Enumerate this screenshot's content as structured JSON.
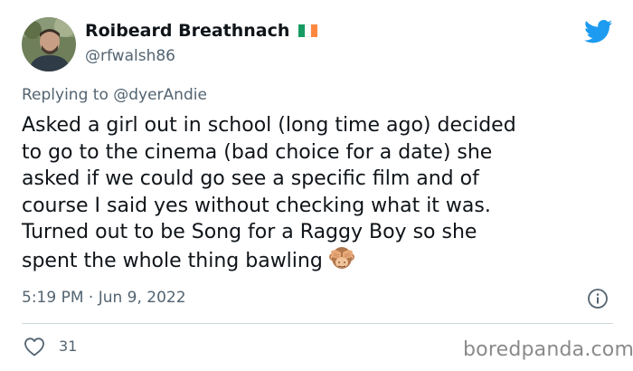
{
  "author": {
    "display_name": "Roibeard Breathnach",
    "handle": "@rfwalsh86",
    "flag_colors": [
      "#169b62",
      "#ffffff",
      "#ff883e"
    ]
  },
  "reply": {
    "prefix": "Replying to ",
    "mention": "@dyerAndie"
  },
  "tweet": {
    "text_lines": [
      "Asked a girl out in school (long time ago) decided",
      "to go to the cinema (bad choice for a date) she",
      "asked if we could go see a specific film and of",
      "course I said yes without checking what it was.",
      "Turned out to be Song for a Raggy Boy so she",
      "spent the whole thing bawling"
    ],
    "emoji": "see-no-evil-monkey",
    "timestamp": "5:19 PM · Jun 9, 2022"
  },
  "actions": {
    "like_count": "31"
  },
  "watermark": "boredpanda.com",
  "colors": {
    "twitter_blue": "#1d9bf0",
    "secondary_text": "#536471",
    "divider": "#cfd9de"
  },
  "icons": [
    "twitter-bird-icon",
    "info-icon",
    "heart-icon",
    "see-no-evil-monkey-emoji"
  ]
}
